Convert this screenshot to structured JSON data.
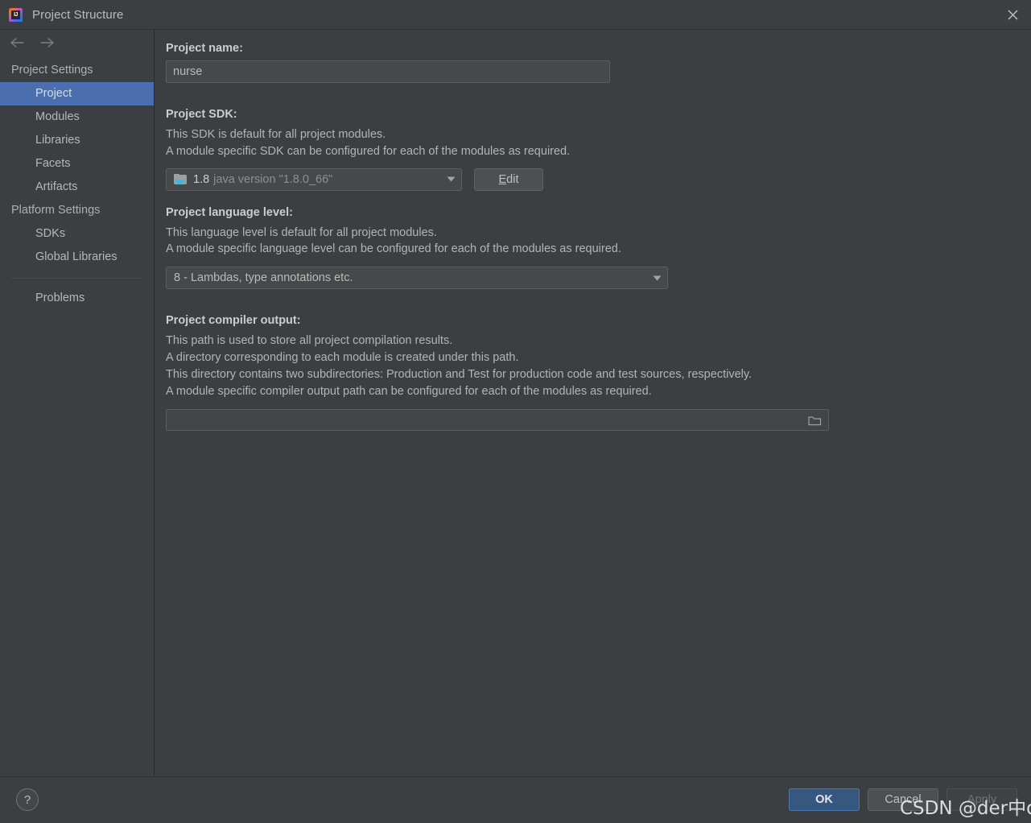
{
  "window": {
    "title": "Project Structure",
    "app_icon": "intellij-idea-icon",
    "close_icon": "close-icon"
  },
  "sidebar": {
    "back_icon": "arrow-left-icon",
    "forward_icon": "arrow-right-icon",
    "groups": [
      {
        "label": "Project Settings",
        "items": [
          {
            "label": "Project",
            "selected": true
          },
          {
            "label": "Modules",
            "selected": false
          },
          {
            "label": "Libraries",
            "selected": false
          },
          {
            "label": "Facets",
            "selected": false
          },
          {
            "label": "Artifacts",
            "selected": false
          }
        ]
      },
      {
        "label": "Platform Settings",
        "items": [
          {
            "label": "SDKs",
            "selected": false
          },
          {
            "label": "Global Libraries",
            "selected": false
          }
        ]
      }
    ],
    "problems": {
      "label": "Problems"
    }
  },
  "main": {
    "project_name": {
      "label": "Project name:",
      "value": "nurse"
    },
    "project_sdk": {
      "label": "Project SDK:",
      "desc_line1": "This SDK is default for all project modules.",
      "desc_line2": "A module specific SDK can be configured for each of the modules as required.",
      "selected_version": "1.8",
      "selected_detail": "java version \"1.8.0_66\"",
      "sdk_icon": "java-sdk-folder-icon",
      "dropdown_icon": "chevron-down-icon",
      "edit_button": {
        "mnemonic": "E",
        "rest": "dit"
      }
    },
    "language_level": {
      "label": "Project language level:",
      "desc_line1": "This language level is default for all project modules.",
      "desc_line2": "A module specific language level can be configured for each of the modules as required.",
      "selected": "8 - Lambdas, type annotations etc.",
      "dropdown_icon": "chevron-down-icon"
    },
    "compiler_output": {
      "label": "Project compiler output:",
      "desc_line1": "This path is used to store all project compilation results.",
      "desc_line2": "A directory corresponding to each module is created under this path.",
      "desc_line3": "This directory contains two subdirectories: Production and Test for production code and test sources, respectively.",
      "desc_line4": "A module specific compiler output path can be configured for each of the modules as required.",
      "value": "",
      "browse_icon": "folder-browse-icon"
    }
  },
  "footer": {
    "help_label": "?",
    "help_icon": "help-question-icon",
    "ok_label": "OK",
    "cancel_label": "Cancel",
    "apply_label": "Apply"
  },
  "watermark": {
    "text": "CSDN @der中der"
  },
  "colors": {
    "background": "#3c3f41",
    "selection_blue": "#4b6eaf",
    "primary_button": "#365880",
    "field_background": "#45494a",
    "text": "#bbbbbb",
    "muted_text": "#8a9094"
  }
}
